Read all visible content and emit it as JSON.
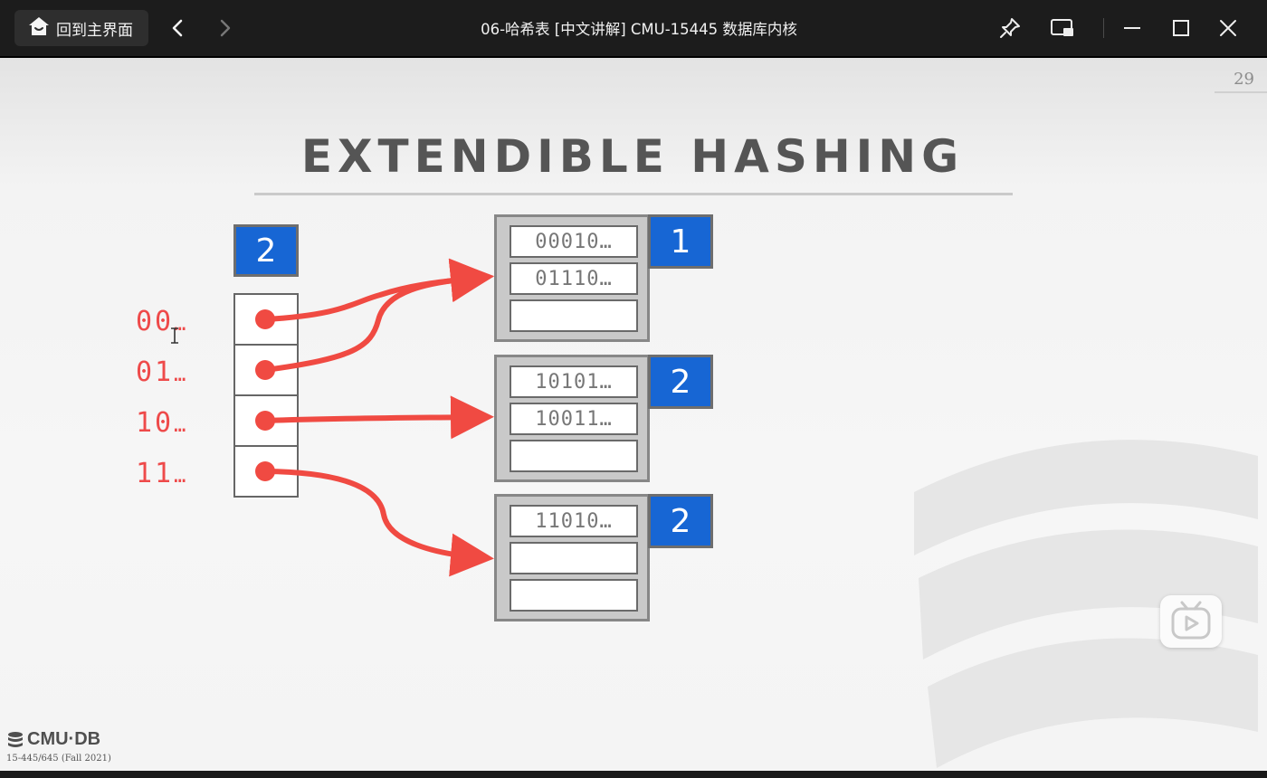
{
  "window": {
    "home_label": "回到主界面",
    "title": "06-哈希表 [中文讲解] CMU-15445 数据库内核"
  },
  "slide": {
    "page_number": "29",
    "title": "EXTENDIBLE HASHING",
    "global_depth": "2",
    "prefixes": [
      {
        "bits": "00",
        "suffix": "…"
      },
      {
        "bits": "01",
        "suffix": "…"
      },
      {
        "bits": "10",
        "suffix": "…"
      },
      {
        "bits": "11",
        "suffix": "…"
      }
    ],
    "buckets": [
      {
        "local_depth": "1",
        "entries": [
          "00010…",
          "01110…",
          ""
        ]
      },
      {
        "local_depth": "2",
        "entries": [
          "10101…",
          "10011…",
          ""
        ]
      },
      {
        "local_depth": "2",
        "entries": [
          "11010…",
          "",
          ""
        ]
      }
    ],
    "footer": {
      "logo": "CMU·DB",
      "course": "15-445/645 (Fall 2021)"
    }
  },
  "colors": {
    "accent_blue": "#1766d4",
    "pointer_red": "#f04a42"
  }
}
